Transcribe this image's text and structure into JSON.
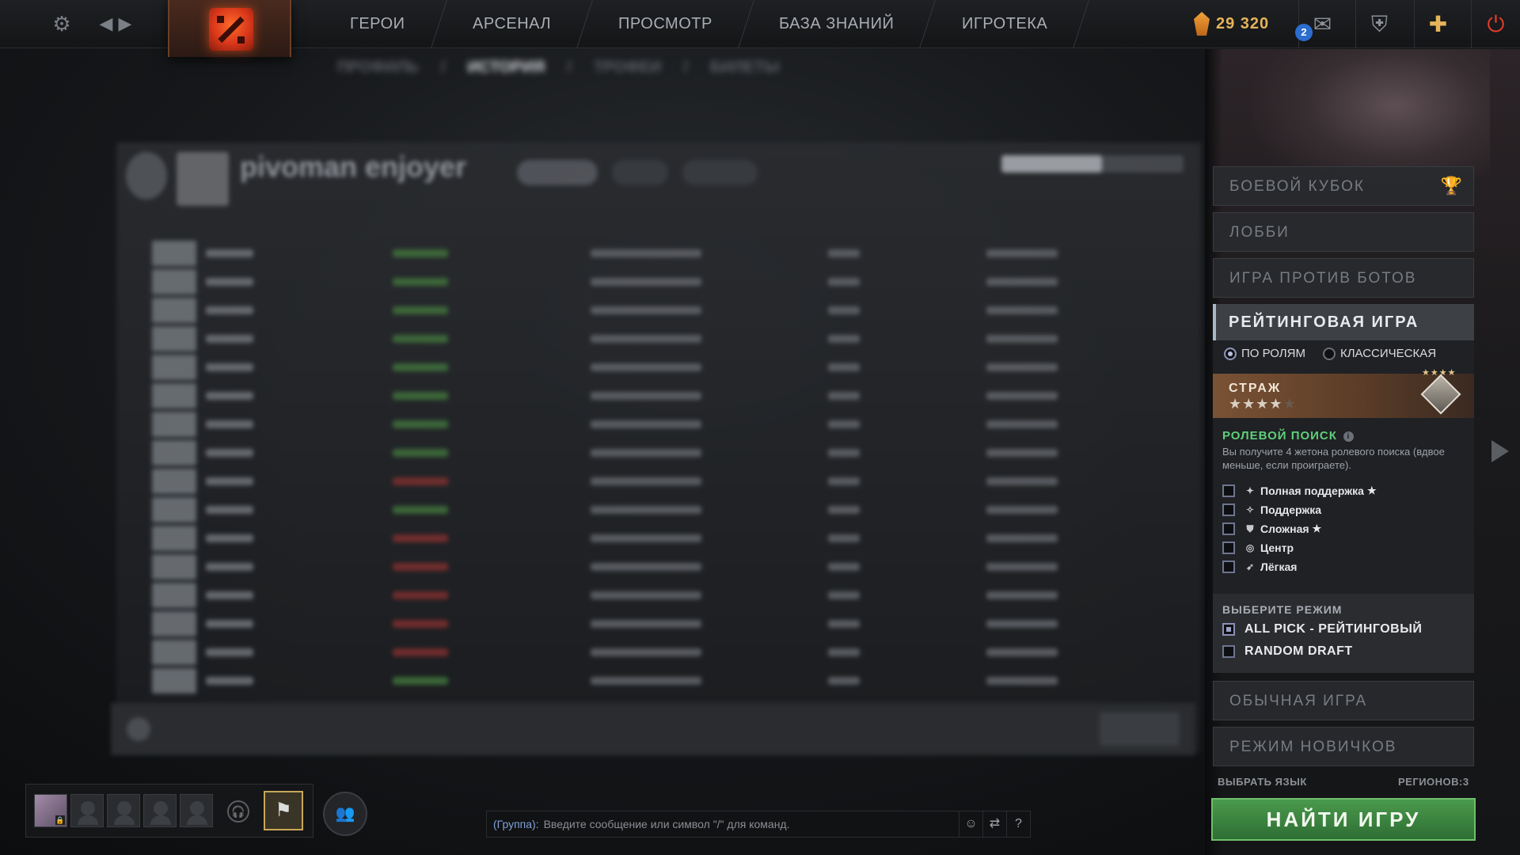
{
  "topbar": {
    "settings_icon": "gear-icon",
    "nav": [
      "ГЕРОИ",
      "АРСЕНАЛ",
      "ПРОСМОТР",
      "БАЗА ЗНАНИЙ",
      "ИГРОТЕКА"
    ],
    "shards": "29 320",
    "mail_count": "2"
  },
  "profile": {
    "subnav": [
      "ПРОФИЛЬ",
      "ИСТОРИЯ",
      "ТРОФЕИ",
      "БИЛЕТЫ"
    ],
    "subnav_active": "ИСТОРИЯ",
    "name": "pivoman enjoyer"
  },
  "right_panel": {
    "battle_cup": "БОЕВОЙ КУБОК",
    "lobby": "ЛОББИ",
    "bots": "ИГРА ПРОТИВ БОТОВ",
    "ranked": "РЕЙТИНГОВАЯ ИГРА",
    "radio_roles": "ПО РОЛЯМ",
    "radio_classic": "КЛАССИЧЕСКАЯ",
    "rank_name": "СТРАЖ",
    "rank_stars": 4,
    "role_search_title": "РОЛЕВОЙ ПОИСК",
    "role_search_desc": "Вы получите 4 жетона ролевого поиска (вдвое меньше, если проиграете).",
    "roles": [
      {
        "label": "Полная поддержка",
        "star": true,
        "icon": "hard-support-icon"
      },
      {
        "label": "Поддержка",
        "star": false,
        "icon": "support-icon"
      },
      {
        "label": "Сложная",
        "star": true,
        "icon": "offlane-icon"
      },
      {
        "label": "Центр",
        "star": false,
        "icon": "mid-icon"
      },
      {
        "label": "Лёгкая",
        "star": false,
        "icon": "carry-icon"
      }
    ],
    "choose_mode": "ВЫБЕРИТЕ РЕЖИМ",
    "modes": [
      {
        "label": "ALL PICK - РЕЙТИНГОВЫЙ",
        "checked": true
      },
      {
        "label": "RANDOM DRAFT",
        "checked": false
      }
    ],
    "normal": "ОБЫЧНАЯ ИГРА",
    "newbie": "РЕЖИМ НОВИЧКОВ",
    "language": "ВЫБРАТЬ ЯЗЫК",
    "regions": "РЕГИОНОВ:3",
    "find": "НАЙТИ ИГРУ"
  },
  "chat": {
    "group_label": "(Группа):",
    "placeholder": "Введите сообщение или символ \"/\" для команд."
  }
}
